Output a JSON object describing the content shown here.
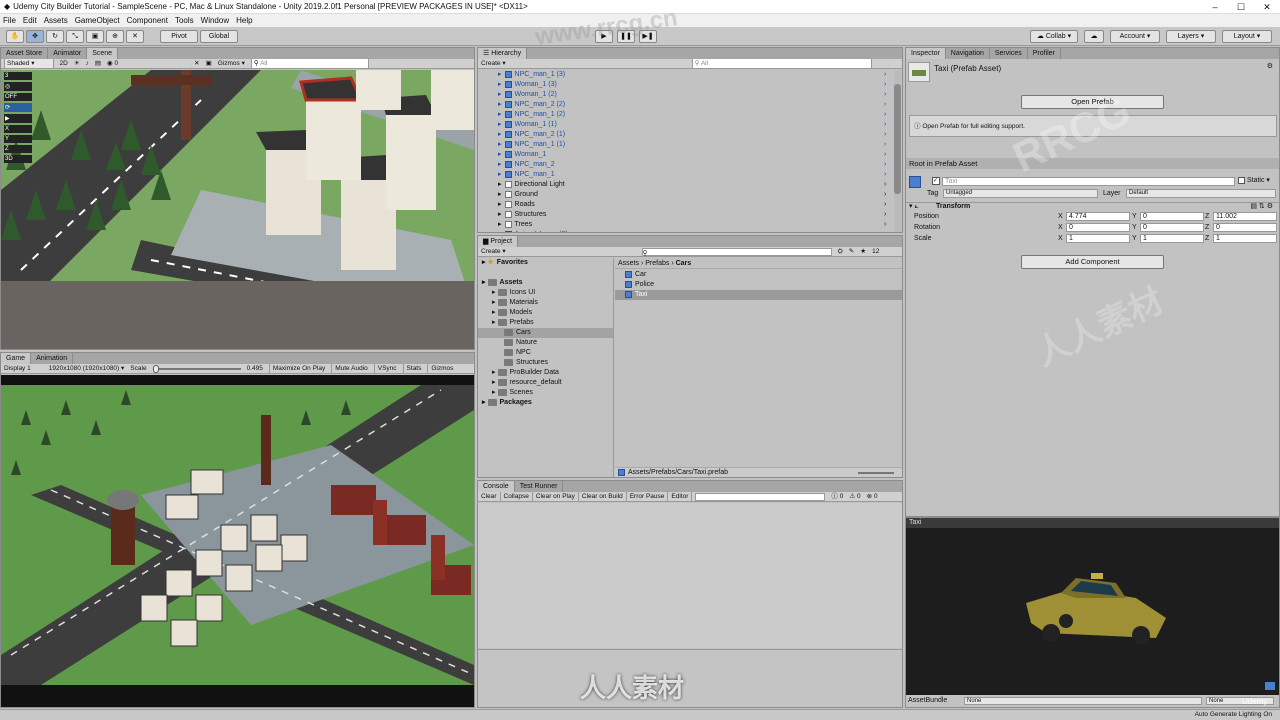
{
  "window": {
    "title": "Udemy City Builder Tutorial - SampleScene - PC, Mac & Linux Standalone - Unity 2019.2.0f1 Personal [PREVIEW PACKAGES IN USE]* <DX11>",
    "min": "–",
    "max": "☐",
    "close": "✕"
  },
  "menu": [
    "File",
    "Edit",
    "Assets",
    "GameObject",
    "Component",
    "Tools",
    "Window",
    "Help"
  ],
  "toolbar": {
    "pivot": "Pivot",
    "global": "Global",
    "collab": "Collab",
    "account": "Account",
    "layers": "Layers",
    "layout": "Layout"
  },
  "scene": {
    "tabs": [
      "Asset Store",
      "Animator",
      "Scene"
    ],
    "shading": "Shaded",
    "mode2d": "2D",
    "gizmos": "Gizmos",
    "search": "All"
  },
  "game": {
    "tabs": [
      "Game",
      "Animation"
    ],
    "display": "Display 1",
    "resolution": "1920x1080 (1920x1080)",
    "scale_label": "Scale",
    "scale_value": "0.495",
    "toggles": [
      "Maximize On Play",
      "Mute Audio",
      "VSync",
      "Stats",
      "Gizmos"
    ]
  },
  "hierarchy": {
    "tab": "Hierarchy",
    "create": "Create",
    "search": "All",
    "items": [
      {
        "label": "NPC_man_1 (3)",
        "type": "prefab"
      },
      {
        "label": "Woman_1 (3)",
        "type": "prefab"
      },
      {
        "label": "Woman_1 (2)",
        "type": "prefab"
      },
      {
        "label": "NPC_man_2 (2)",
        "type": "prefab"
      },
      {
        "label": "NPC_man_1 (2)",
        "type": "prefab"
      },
      {
        "label": "Woman_1 (1)",
        "type": "prefab"
      },
      {
        "label": "NPC_man_2 (1)",
        "type": "prefab"
      },
      {
        "label": "NPC_man_1 (1)",
        "type": "prefab"
      },
      {
        "label": "Woman_1",
        "type": "prefab"
      },
      {
        "label": "NPC_man_2",
        "type": "prefab"
      },
      {
        "label": "NPC_man_1",
        "type": "prefab"
      },
      {
        "label": "Directional Light",
        "type": "object"
      },
      {
        "label": "Ground",
        "type": "object"
      },
      {
        "label": "Roads",
        "type": "object"
      },
      {
        "label": "Structures",
        "type": "object"
      },
      {
        "label": "Trees",
        "type": "object"
      },
      {
        "label": "Animal_Lama (2)",
        "type": "prefab"
      }
    ]
  },
  "project": {
    "tab": "Project",
    "create": "Create",
    "count": "12",
    "tree": [
      {
        "label": "Favorites",
        "bold": true,
        "depth": 0
      },
      {
        "label": "Assets",
        "bold": true,
        "depth": 0
      },
      {
        "label": "Icons UI",
        "depth": 1
      },
      {
        "label": "Materials",
        "depth": 1
      },
      {
        "label": "Models",
        "depth": 1
      },
      {
        "label": "Prefabs",
        "depth": 1
      },
      {
        "label": "Cars",
        "depth": 2,
        "selected": true
      },
      {
        "label": "Nature",
        "depth": 2
      },
      {
        "label": "NPC",
        "depth": 2
      },
      {
        "label": "Structures",
        "depth": 2
      },
      {
        "label": "ProBuilder Data",
        "depth": 1
      },
      {
        "label": "resource_default",
        "depth": 1
      },
      {
        "label": "Scenes",
        "depth": 1
      },
      {
        "label": "Packages",
        "bold": true,
        "depth": 0
      }
    ],
    "breadcrumb": [
      "Assets",
      "Prefabs",
      "Cars"
    ],
    "files": [
      {
        "label": "Car"
      },
      {
        "label": "Police"
      },
      {
        "label": "Taxi",
        "selected": true
      }
    ],
    "path": "Assets/Prefabs/Cars/Taxi.prefab"
  },
  "console": {
    "tabs": [
      "Console",
      "Test Runner"
    ],
    "buttons": [
      "Clear",
      "Collapse",
      "Clear on Play",
      "Clear on Build",
      "Error Pause",
      "Editor"
    ],
    "counts": [
      "0",
      "0",
      "0"
    ]
  },
  "inspector": {
    "tabs": [
      "Inspector",
      "Navigation",
      "Services",
      "Profiler"
    ],
    "title": "Taxi (Prefab Asset)",
    "open_prefab": "Open Prefab",
    "help": "Open Prefab for full editing support.",
    "root_header": "Root in Prefab Asset",
    "object_name": "Taxi",
    "static": "Static",
    "tag_label": "Tag",
    "tag": "Untagged",
    "layer_label": "Layer",
    "layer": "Default",
    "transform": "Transform",
    "rows": [
      {
        "label": "Position",
        "x": "4.774",
        "y": "0",
        "z": "11.002"
      },
      {
        "label": "Rotation",
        "x": "0",
        "y": "0",
        "z": "0"
      },
      {
        "label": "Scale",
        "x": "1",
        "y": "1",
        "z": "1"
      }
    ],
    "add_component": "Add Component",
    "preview_title": "Taxi",
    "asset_bundle": "AssetBundle",
    "bundle_value": "None",
    "bundle_variant": "None"
  },
  "status": "Auto Generate Lighting On",
  "watermarks": [
    "RRCG",
    "人人素材",
    "www.rrcg.cn",
    "Udemy"
  ],
  "colors": {
    "grass": "#72a65a",
    "road": "#3d3d3d",
    "taxi": "#b0a03a",
    "selection": "#a3a3a3",
    "prefab": "#4a7fcf"
  }
}
